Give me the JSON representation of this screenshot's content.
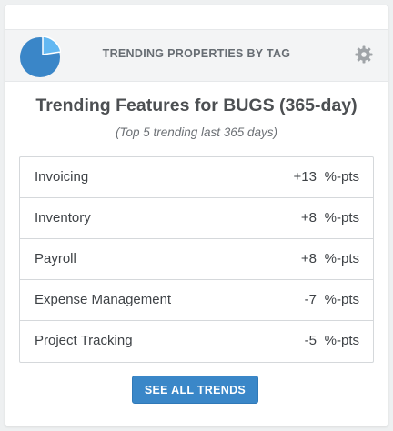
{
  "widget": {
    "header_title": "TRENDING PROPERTIES BY TAG",
    "pie_icon": "pie-chart-icon",
    "settings_icon": "gear-icon",
    "colors": {
      "pie_main": "#3a86c8",
      "pie_slice": "#63b8f2",
      "button": "#3a87c8",
      "gear": "#a0a4a8"
    }
  },
  "content": {
    "title": "Trending Features for BUGS (365-day)",
    "subtitle": "(Top 5 trending last 365 days)"
  },
  "trends": [
    {
      "label": "Invoicing",
      "value": "+13",
      "unit": "%-pts"
    },
    {
      "label": "Inventory",
      "value": "+8",
      "unit": "%-pts"
    },
    {
      "label": "Payroll",
      "value": "+8",
      "unit": "%-pts"
    },
    {
      "label": "Expense Management",
      "value": "-7",
      "unit": "%-pts"
    },
    {
      "label": "Project Tracking",
      "value": "-5",
      "unit": "%-pts"
    }
  ],
  "actions": {
    "see_all_label": "SEE ALL TRENDS"
  }
}
